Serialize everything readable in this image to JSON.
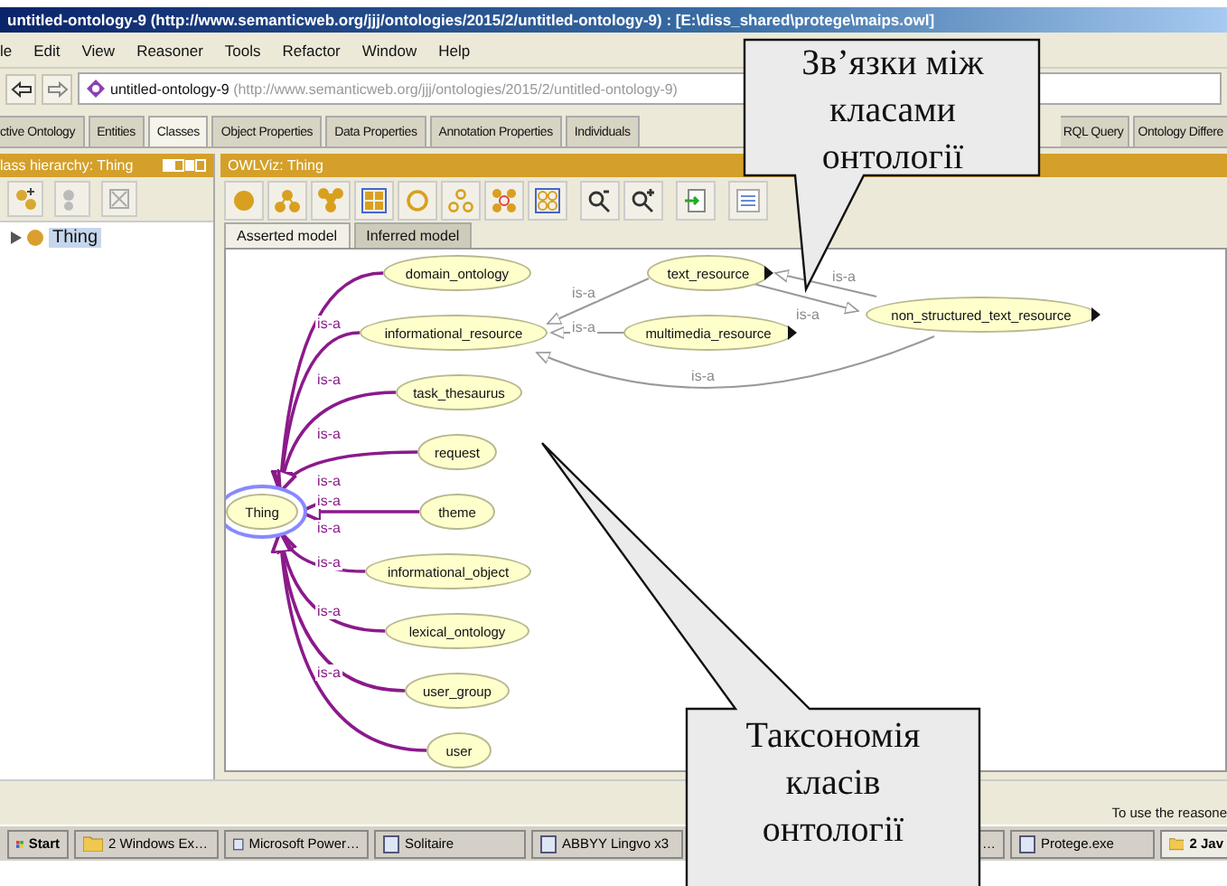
{
  "window": {
    "title": "untitled-ontology-9 (http://www.semanticweb.org/jjj/ontologies/2015/2/untitled-ontology-9)  : [E:\\diss_shared\\protege\\maips.owl]"
  },
  "menu": [
    "le",
    "Edit",
    "View",
    "Reasoner",
    "Tools",
    "Refactor",
    "Window",
    "Help"
  ],
  "navigation": {
    "ontology": "untitled-ontology-9",
    "iri": "(http://www.semanticweb.org/jjj/ontologies/2015/2/untitled-ontology-9)"
  },
  "tabs": [
    {
      "label": "ctive Ontology",
      "selected": false
    },
    {
      "label": "Entities",
      "selected": false
    },
    {
      "label": "Classes",
      "selected": true
    },
    {
      "label": "Object Properties",
      "selected": false
    },
    {
      "label": "Data Properties",
      "selected": false
    },
    {
      "label": "Annotation Properties",
      "selected": false
    },
    {
      "label": "Individuals",
      "selected": false
    },
    {
      "label": "RQL Query",
      "selected": false
    },
    {
      "label": "Ontology Differe",
      "selected": false
    }
  ],
  "class_hierarchy": {
    "title": "lass hierarchy: Thing",
    "tree": [
      {
        "label": "Thing",
        "selected": true,
        "expanded": false
      }
    ]
  },
  "owlviz": {
    "title": "OWLViz: Thing",
    "model_tabs": [
      {
        "label": "Asserted model",
        "selected": true
      },
      {
        "label": "Inferred model",
        "selected": false
      }
    ],
    "graph": {
      "nodes": [
        {
          "label": "Thing",
          "selected": true,
          "hidden_children": false
        },
        {
          "label": "domain_ontology",
          "selected": false,
          "hidden_children": false
        },
        {
          "label": "informational_resource",
          "selected": false,
          "hidden_children": false
        },
        {
          "label": "task_thesaurus",
          "selected": false,
          "hidden_children": false
        },
        {
          "label": "request",
          "selected": false,
          "hidden_children": false
        },
        {
          "label": "theme",
          "selected": false,
          "hidden_children": false
        },
        {
          "label": "informational_object",
          "selected": false,
          "hidden_children": false
        },
        {
          "label": "lexical_ontology",
          "selected": false,
          "hidden_children": false
        },
        {
          "label": "user_group",
          "selected": false,
          "hidden_children": false
        },
        {
          "label": "user",
          "selected": false,
          "hidden_children": false
        },
        {
          "label": "text_resource",
          "selected": false,
          "hidden_children": true
        },
        {
          "label": "multimedia_resource",
          "selected": false,
          "hidden_children": true
        },
        {
          "label": "non_structured_text_resource",
          "selected": false,
          "hidden_children": true
        }
      ],
      "edges": [
        {
          "label": "is-a",
          "kind": "root"
        },
        {
          "label": "is-a",
          "kind": "root"
        },
        {
          "label": "is-a",
          "kind": "root"
        },
        {
          "label": "is-a",
          "kind": "root"
        },
        {
          "label": "is-a",
          "kind": "root"
        },
        {
          "label": "is-a",
          "kind": "root"
        },
        {
          "label": "is-a",
          "kind": "root"
        },
        {
          "label": "is-a",
          "kind": "root"
        },
        {
          "label": "is-a",
          "kind": "root"
        },
        {
          "label": "is-a",
          "kind": "link"
        },
        {
          "label": "is-a",
          "kind": "link"
        },
        {
          "label": "is-a",
          "kind": "link"
        },
        {
          "label": "is-a",
          "kind": "link"
        },
        {
          "label": "is-a",
          "kind": "link"
        }
      ]
    }
  },
  "callouts": [
    {
      "text": "Зв’язки між класами онтології"
    },
    {
      "text": "Таксономія класів онтології"
    }
  ],
  "status_bar": "To use the reasone",
  "taskbar": [
    {
      "label": "Start",
      "kind": "start"
    },
    {
      "label": "2 Windows Ex…",
      "kind": "group"
    },
    {
      "label": "Microsoft Power…",
      "kind": "app"
    },
    {
      "label": "Solitaire",
      "kind": "app"
    },
    {
      "label": "ABBYY Lingvo x3",
      "kind": "app"
    },
    {
      "label": "…",
      "kind": "app"
    },
    {
      "label": "Protege.exe",
      "kind": "app"
    },
    {
      "label": "2 Jav",
      "kind": "group"
    }
  ]
}
